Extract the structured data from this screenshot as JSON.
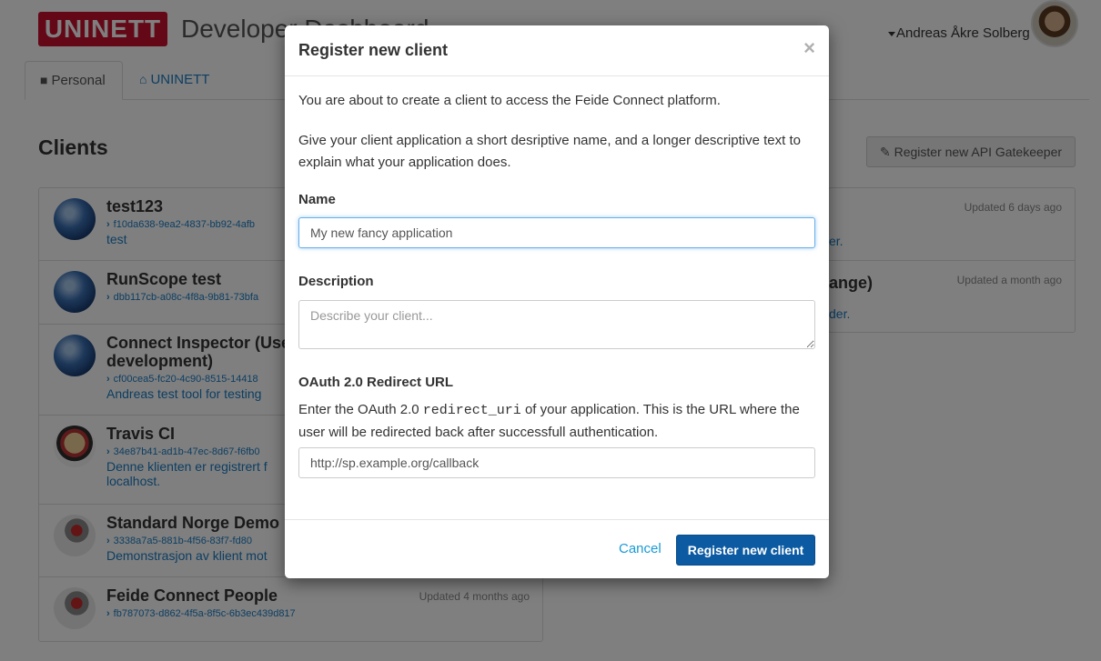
{
  "header": {
    "logo_text": "UNINETT",
    "app_title": "Developer Dashboard",
    "user_name": "Andreas Åkre Solberg"
  },
  "tabs": [
    {
      "label": "Personal",
      "icon": "user-icon"
    },
    {
      "label": "UNINETT",
      "icon": "home-icon"
    }
  ],
  "clients_section": {
    "title": "Clients",
    "gatekeeper_button": "Register new API Gatekeeper"
  },
  "clients": [
    {
      "name": "test123",
      "id": "f10da638-9ea2-4837-bb92-4afb",
      "desc": "test",
      "icon": "globe-icon"
    },
    {
      "name": "RunScope test",
      "id": "dbb117cb-a08c-4f8a-9b81-73bfa",
      "desc": "",
      "icon": "globe-icon"
    },
    {
      "name": "Connect Inspector (Use development)",
      "id": "cf00cea5-fc20-4c90-8515-14418",
      "desc": "Andreas test tool for testing",
      "icon": "globe-icon"
    },
    {
      "name": "Travis CI",
      "id": "34e87b41-ad1b-47ec-8d67-f6fb0",
      "desc": "Denne klienten er registrert f localhost.",
      "icon": "travis-icon"
    },
    {
      "name": "Standard Norge Demo",
      "id": "3338a7a5-881b-4f56-83f7-fd80",
      "desc": "Demonstrasjon av klient mot",
      "icon": "people-icon"
    },
    {
      "name": "Feide Connect People",
      "id": "fb787073-d862-4f5a-8f5c-6b3ec439d817",
      "desc": "",
      "updated": "Updated 4 months ago",
      "icon": "people-icon"
    }
  ],
  "clients_right": [
    {
      "updated": "Updated 6 days ago",
      "name_fragment": "",
      "link_fragment": "er."
    },
    {
      "updated": "Updated a month ago",
      "name_fragment": "ange)",
      "link_fragment": "der."
    }
  ],
  "modal": {
    "title": "Register new client",
    "close_symbol": "×",
    "intro": "You are about to create a client to access the Feide Connect platform.",
    "instructions": "Give your client application a short desriptive name, and a longer descriptive text to explain what your application does.",
    "name_label": "Name",
    "name_value": "My new fancy application",
    "description_label": "Description",
    "description_placeholder": "Describe your client...",
    "redirect_label": "OAuth 2.0 Redirect URL",
    "redirect_help_before": "Enter the OAuth 2.0 ",
    "redirect_help_code": "redirect_uri",
    "redirect_help_after": " of your application. This is the URL where the user will be redirected back after successfull authentication.",
    "redirect_value": "http://sp.example.org/callback",
    "cancel_label": "Cancel",
    "submit_label": "Register new client"
  },
  "colors": {
    "brand_red": "#c8102e",
    "primary_blue": "#0b5aa2",
    "link_blue": "#1a7dc5"
  }
}
